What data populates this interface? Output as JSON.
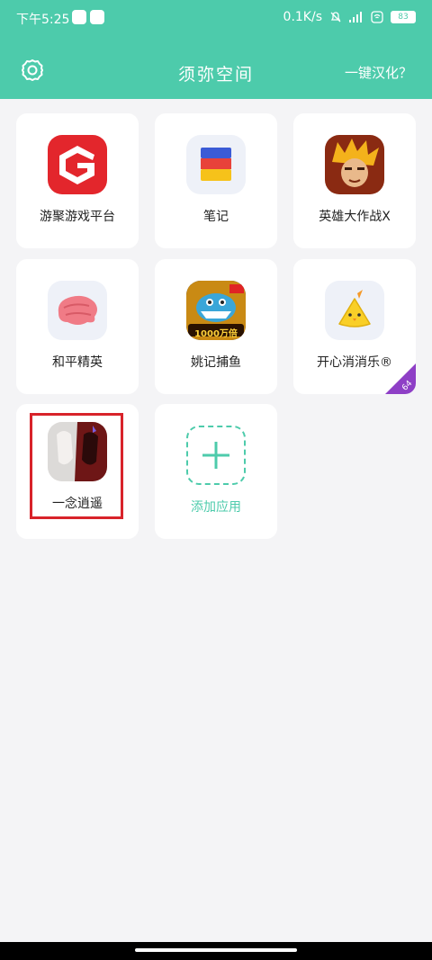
{
  "status_bar": {
    "time": "下午5:25",
    "network_speed": "0.1K/s",
    "battery": "83"
  },
  "header": {
    "title": "须弥空间",
    "right_link": "一键汉化？"
  },
  "apps": [
    {
      "label": "游聚游戏平台"
    },
    {
      "label": "笔记"
    },
    {
      "label": "英雄大作战X"
    },
    {
      "label": "和平精英"
    },
    {
      "label": "姚记捕鱼",
      "badge": "1000万倍"
    },
    {
      "label": "开心消消乐®",
      "corner": "64"
    },
    {
      "label": "一念逍遥"
    }
  ],
  "add_app": {
    "label": "添加应用"
  },
  "colors": {
    "accent": "#4dcbab",
    "highlight": "#d8232a",
    "corner": "#8e3fc6"
  }
}
